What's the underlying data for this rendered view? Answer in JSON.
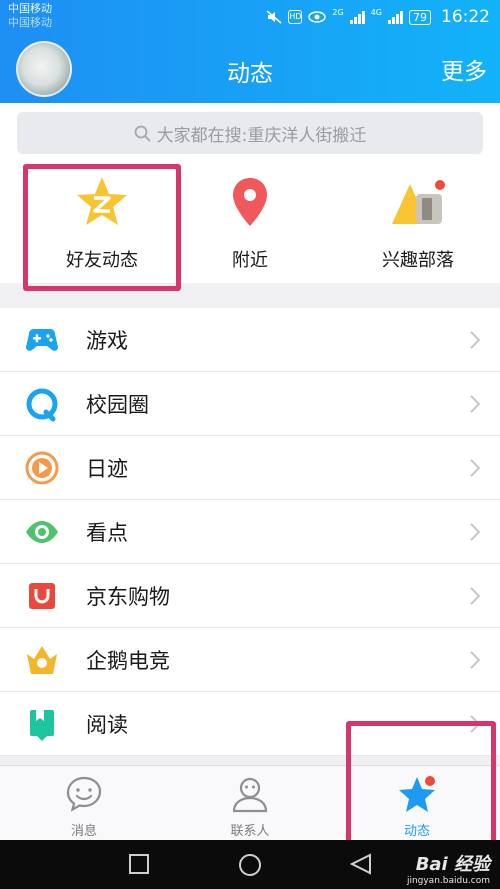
{
  "status_bar": {
    "carrier_1": "中国移动",
    "carrier_2": "中国移动",
    "network_1": "2G",
    "network_2": "4G",
    "hd_label": "HD",
    "battery": "79",
    "time": "16:22"
  },
  "header": {
    "title": "动态",
    "more_label": "更多"
  },
  "search": {
    "placeholder": "大家都在搜:重庆洋人街搬迁"
  },
  "quick_entries": [
    {
      "label": "好友动态",
      "icon": "star-z-icon"
    },
    {
      "label": "附近",
      "icon": "location-pin-icon"
    },
    {
      "label": "兴趣部落",
      "icon": "tribe-icon"
    }
  ],
  "list_items": [
    {
      "label": "游戏",
      "icon": "gamepad-icon",
      "color": "#1aa3f0"
    },
    {
      "label": "校园圈",
      "icon": "campus-icon",
      "color": "#1aa3f0"
    },
    {
      "label": "日迹",
      "icon": "daily-trace-icon",
      "color": "#f59a4a"
    },
    {
      "label": "看点",
      "icon": "eye-icon",
      "color": "#4fc36b"
    },
    {
      "label": "京东购物",
      "icon": "jd-bag-icon",
      "color": "#e9483c"
    },
    {
      "label": "企鹅电竞",
      "icon": "esports-crown-icon",
      "color": "#f3b62a"
    },
    {
      "label": "阅读",
      "icon": "book-icon",
      "color": "#1ec6a0"
    }
  ],
  "bottom_nav": [
    {
      "label": "消息",
      "icon": "message-icon",
      "active": false
    },
    {
      "label": "联系人",
      "icon": "contacts-icon",
      "active": false
    },
    {
      "label": "动态",
      "icon": "star-icon",
      "active": true
    }
  ],
  "watermark": {
    "main": "Bai 经验",
    "sub": "jingyan.baidu.com"
  },
  "colors": {
    "accent": "#1d9bf4",
    "highlight": "#d6356e",
    "badge": "#f04a3a"
  }
}
